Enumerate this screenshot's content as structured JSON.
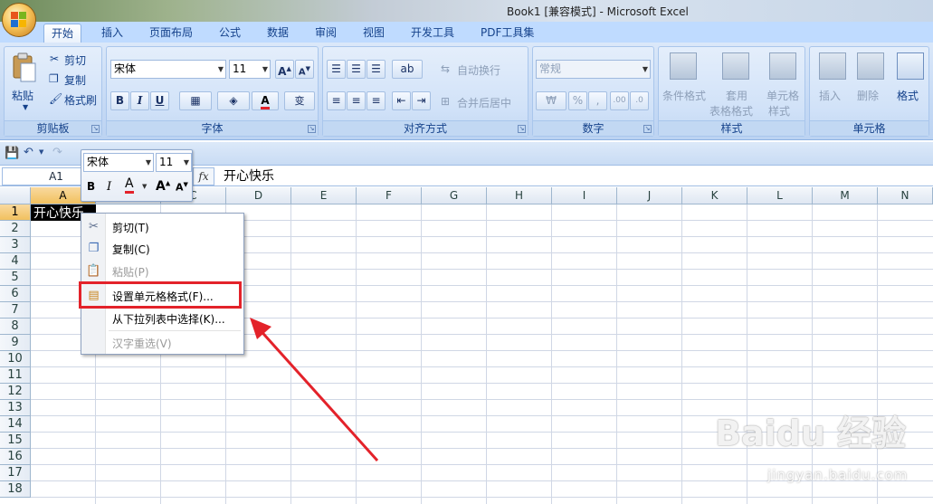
{
  "window": {
    "title": "Book1  [兼容模式] - Microsoft Excel"
  },
  "tabs": [
    "开始",
    "插入",
    "页面布局",
    "公式",
    "数据",
    "审阅",
    "视图",
    "开发工具",
    "PDF工具集"
  ],
  "ribbon": {
    "clipboard": {
      "label": "剪贴板",
      "paste": "粘贴",
      "cut": "剪切",
      "copy": "复制",
      "format_painter": "格式刷"
    },
    "font": {
      "label": "字体",
      "font_name": "宋体",
      "font_size": "11"
    },
    "alignment": {
      "label": "对齐方式",
      "wrap_text": "自动换行",
      "merge_center": "合并后居中"
    },
    "number": {
      "label": "数字",
      "format": "常规"
    },
    "styles": {
      "label": "样式",
      "conditional": "条件格式",
      "table_line1": "套用",
      "table_line2": "表格格式",
      "cell_styles_line1": "单元格",
      "cell_styles_line2": "样式"
    },
    "cells": {
      "label": "单元格",
      "insert": "插入",
      "delete": "删除",
      "format": "格式"
    }
  },
  "formula_bar": {
    "name_box": "A1",
    "fx": "fx",
    "content": "开心快乐"
  },
  "columns": [
    "A",
    "B",
    "C",
    "D",
    "E",
    "F",
    "G",
    "H",
    "I",
    "J",
    "K",
    "L",
    "M",
    "N"
  ],
  "rows": [
    "1",
    "2",
    "3",
    "4",
    "5",
    "6",
    "7",
    "8",
    "9",
    "10",
    "11",
    "12",
    "13",
    "14",
    "15",
    "16",
    "17",
    "18"
  ],
  "cell_a1": "开心快乐",
  "mini_toolbar": {
    "font_name": "宋体",
    "font_size": "11"
  },
  "context_menu": {
    "cut": "剪切(T)",
    "copy": "复制(C)",
    "paste": "粘贴(P)",
    "format_cells": "设置单元格格式(F)...",
    "pick_list": "从下拉列表中选择(K)...",
    "reconvert": "汉字重选(V)"
  },
  "colors": {
    "highlight": "#e3222a",
    "ribbon_text": "#15428b"
  },
  "watermark": {
    "brand": "Baidu 经验",
    "url": "jingyan.baidu.com"
  }
}
